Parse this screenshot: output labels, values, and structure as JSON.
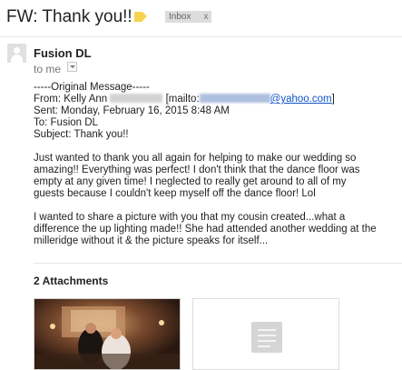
{
  "email": {
    "subject": "FW: Thank you!!",
    "label_chip": {
      "text": "Inbox",
      "close": "x"
    }
  },
  "message": {
    "sender": "Fusion DL",
    "recipient": "to me",
    "body": {
      "original_header": "-----Original Message-----",
      "from_prefix": "From: Kelly Ann ",
      "from_mailto": "[mailto:",
      "from_email_domain": "@yahoo.com",
      "from_close": "]",
      "sent": "Sent: Monday, February 16, 2015 8:48 AM",
      "to": "To: Fusion DL",
      "subject": "Subject: Thank you!!",
      "p1": [
        "Just wanted to thank you all again for helping to make our wedding so",
        "amazing!! Everything was perfect! I don't think that the dance floor was",
        "empty at any given time! I neglected to really get around to all of my",
        "guests because I couldn't keep myself off the dance floor! Lol"
      ],
      "p2": [
        "I wanted to share a picture with you that my cousin created...what a",
        "difference the up lighting made!! She had attended another wedding at the",
        "milleridge without it & the picture speaks for itself..."
      ]
    }
  },
  "attachments": {
    "title": "2 Attachments"
  },
  "colors": {
    "label": "#f6d34f",
    "link": "#1155cc",
    "chip_bg": "#dddddd"
  }
}
